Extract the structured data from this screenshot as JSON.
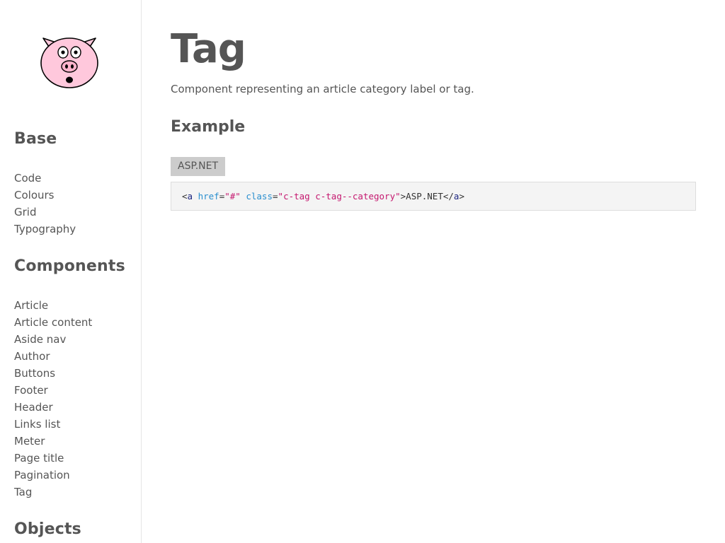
{
  "sidebar": {
    "logo_icon": "pig-face-icon",
    "sections": [
      {
        "heading": "Base",
        "items": [
          "Code",
          "Colours",
          "Grid",
          "Typography"
        ]
      },
      {
        "heading": "Components",
        "items": [
          "Article",
          "Article content",
          "Aside nav",
          "Author",
          "Buttons",
          "Footer",
          "Header",
          "Links list",
          "Meter",
          "Page title",
          "Pagination",
          "Tag"
        ]
      },
      {
        "heading": "Objects",
        "items": []
      }
    ]
  },
  "main": {
    "title": "Tag",
    "lead": "Component representing an article category label or tag.",
    "example_heading": "Example",
    "tag_label": "ASP.NET",
    "code": {
      "open_bracket": "<",
      "tag_name": "a",
      "attr_href": "href",
      "eq": "=",
      "quote": "\"",
      "href_value": "#",
      "attr_class": "class",
      "class_value": "c-tag c-tag--category",
      "close_bracket": ">",
      "text": "ASP.NET",
      "end_open": "</",
      "end_close": ">"
    }
  },
  "colors": {
    "tag_background": "#cccccc",
    "code_background": "#f4f4f4",
    "code_attr": "#2a8fcf",
    "code_value": "#c5186f",
    "code_tag": "#1a237e",
    "pig_pink": "#ffc8dc"
  }
}
